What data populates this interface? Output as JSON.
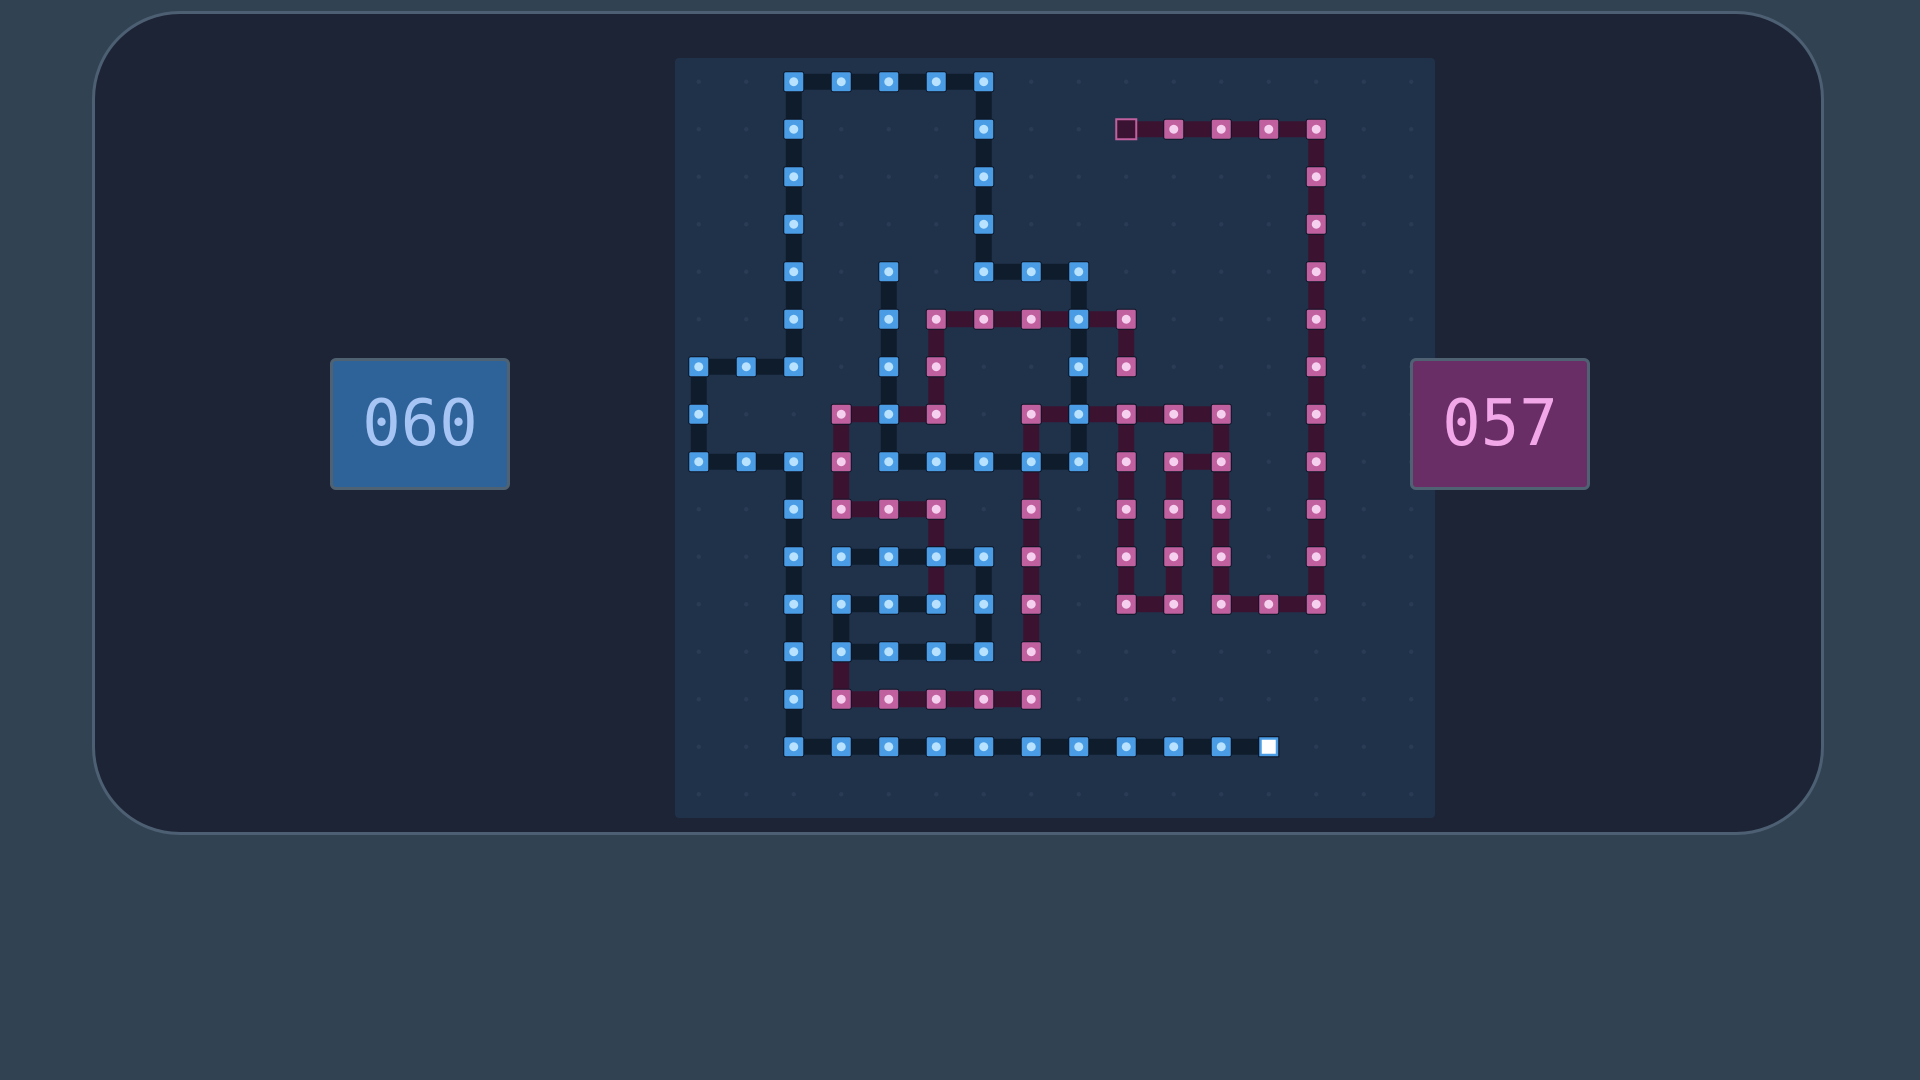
{
  "scores": {
    "blue": "060",
    "pink": "057"
  },
  "colors": {
    "blue_cell": "#4a9de4",
    "blue_core": "#b8e2ff",
    "blue_link": "#0e1c2c",
    "pink_cell": "#c0609e",
    "pink_core": "#f6d0ef",
    "pink_link": "#3b1230",
    "grid_dot": "#2a3c55",
    "head": "#ffffff"
  },
  "grid": {
    "cols": 16,
    "rows": 16
  },
  "blue_snake": [
    [
      12,
      14
    ],
    [
      11,
      14
    ],
    [
      10,
      14
    ],
    [
      9,
      14
    ],
    [
      8,
      14
    ],
    [
      7,
      14
    ],
    [
      6,
      14
    ],
    [
      5,
      14
    ],
    [
      4,
      14
    ],
    [
      3,
      14
    ],
    [
      2,
      14
    ],
    [
      2,
      13
    ],
    [
      2,
      12
    ],
    [
      2,
      11
    ],
    [
      2,
      10
    ],
    [
      2,
      9
    ],
    [
      2,
      8
    ],
    [
      1,
      8
    ],
    [
      0,
      8
    ],
    [
      0,
      7
    ],
    [
      0,
      6
    ],
    [
      1,
      6
    ],
    [
      2,
      6
    ],
    [
      2,
      5
    ],
    [
      2,
      4
    ],
    [
      2,
      3
    ],
    [
      2,
      2
    ],
    [
      2,
      1
    ],
    [
      2,
      0
    ],
    [
      3,
      0
    ],
    [
      4,
      0
    ],
    [
      5,
      0
    ],
    [
      6,
      0
    ],
    [
      6,
      1
    ],
    [
      6,
      2
    ],
    [
      6,
      3
    ],
    [
      6,
      4
    ],
    [
      7,
      4
    ],
    [
      8,
      4
    ],
    [
      8,
      5
    ],
    [
      8,
      6
    ],
    [
      8,
      7
    ],
    [
      8,
      8
    ],
    [
      7,
      8
    ],
    [
      6,
      8
    ],
    [
      5,
      8
    ],
    [
      4,
      8
    ],
    [
      4,
      7
    ],
    [
      4,
      6
    ],
    [
      4,
      5
    ],
    [
      4,
      4
    ]
  ],
  "blue_loop": [
    [
      3,
      10
    ],
    [
      4,
      10
    ],
    [
      5,
      10
    ],
    [
      6,
      10
    ],
    [
      6,
      11
    ],
    [
      6,
      12
    ],
    [
      5,
      12
    ],
    [
      4,
      12
    ],
    [
      3,
      12
    ],
    [
      3,
      11
    ],
    [
      4,
      11
    ],
    [
      5,
      11
    ]
  ],
  "pink_snake": [
    [
      7,
      13
    ],
    [
      6,
      13
    ],
    [
      5,
      13
    ],
    [
      4,
      13
    ],
    [
      3,
      13
    ],
    [
      3,
      12
    ],
    [
      3,
      11
    ],
    [
      7,
      12
    ],
    [
      7,
      11
    ],
    [
      7,
      10
    ],
    [
      7,
      9
    ],
    [
      7,
      8
    ],
    [
      7,
      7
    ],
    [
      8,
      7
    ],
    [
      9,
      7
    ],
    [
      10,
      7
    ],
    [
      11,
      7
    ],
    [
      11,
      8
    ],
    [
      11,
      9
    ],
    [
      11,
      10
    ],
    [
      11,
      11
    ],
    [
      12,
      11
    ],
    [
      13,
      11
    ],
    [
      13,
      10
    ],
    [
      13,
      9
    ],
    [
      13,
      8
    ],
    [
      13,
      7
    ],
    [
      13,
      6
    ],
    [
      13,
      5
    ],
    [
      13,
      4
    ],
    [
      13,
      3
    ],
    [
      13,
      2
    ],
    [
      13,
      1
    ],
    [
      12,
      1
    ],
    [
      11,
      1
    ],
    [
      10,
      1
    ],
    [
      9,
      1
    ],
    [
      9,
      7
    ],
    [
      9,
      8
    ],
    [
      9,
      9
    ],
    [
      9,
      10
    ],
    [
      9,
      11
    ],
    [
      10,
      11
    ],
    [
      10,
      10
    ],
    [
      10,
      9
    ],
    [
      10,
      8
    ],
    [
      11,
      8
    ],
    [
      9,
      6
    ],
    [
      9,
      5
    ],
    [
      8,
      5
    ],
    [
      7,
      5
    ],
    [
      6,
      5
    ],
    [
      5,
      5
    ],
    [
      5,
      6
    ],
    [
      5,
      7
    ],
    [
      4,
      7
    ],
    [
      3,
      7
    ],
    [
      3,
      8
    ],
    [
      3,
      9
    ],
    [
      4,
      9
    ],
    [
      5,
      9
    ],
    [
      5,
      10
    ],
    [
      5,
      11
    ]
  ],
  "pink_tail": [
    9,
    1
  ]
}
